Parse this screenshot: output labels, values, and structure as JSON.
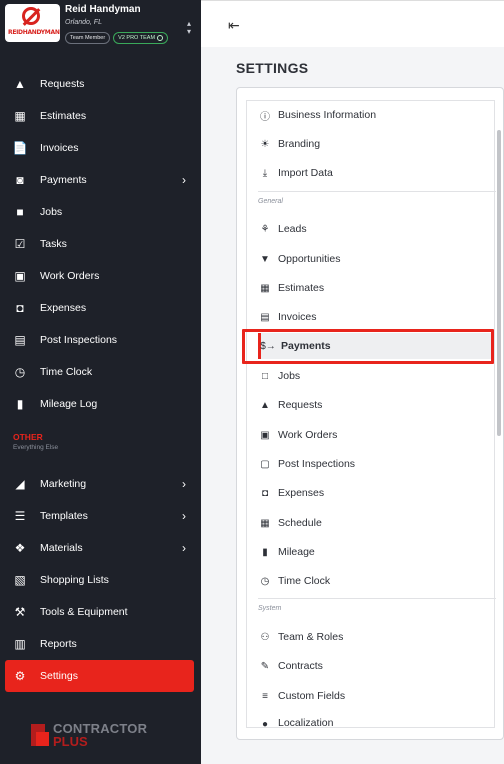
{
  "company": {
    "logo_text": "REIDHANDYMAN",
    "name": "Reid Handyman",
    "location": "Orlando, FL",
    "badges": [
      "Team Member",
      "V2 PRO TEAM"
    ]
  },
  "sidebar": {
    "items": [
      {
        "label": "Requests",
        "icon": "requests-icon"
      },
      {
        "label": "Estimates",
        "icon": "estimates-icon"
      },
      {
        "label": "Invoices",
        "icon": "invoices-icon"
      },
      {
        "label": "Payments",
        "icon": "payments-icon",
        "expandable": true
      },
      {
        "label": "Jobs",
        "icon": "jobs-icon"
      },
      {
        "label": "Tasks",
        "icon": "tasks-icon"
      },
      {
        "label": "Work Orders",
        "icon": "work-orders-icon"
      },
      {
        "label": "Expenses",
        "icon": "expenses-icon"
      },
      {
        "label": "Post Inspections",
        "icon": "post-inspections-icon"
      },
      {
        "label": "Time Clock",
        "icon": "clock-icon"
      },
      {
        "label": "Mileage Log",
        "icon": "fuel-icon"
      }
    ],
    "other_title": "OTHER",
    "other_subtitle": "Everything Else",
    "other_items": [
      {
        "label": "Marketing",
        "icon": "megaphone-icon",
        "expandable": true
      },
      {
        "label": "Templates",
        "icon": "templates-icon",
        "expandable": true
      },
      {
        "label": "Materials",
        "icon": "materials-icon",
        "expandable": true
      },
      {
        "label": "Shopping Lists",
        "icon": "cart-icon"
      },
      {
        "label": "Tools & Equipment",
        "icon": "tools-icon"
      },
      {
        "label": "Reports",
        "icon": "reports-icon"
      },
      {
        "label": "Settings",
        "icon": "gear-icon",
        "active": true
      }
    ],
    "brand_top": "CONTRACTOR",
    "brand_bottom": "PLUS"
  },
  "main": {
    "page_title": "SETTINGS",
    "menu": {
      "top_items": [
        "Business Information",
        "Branding",
        "Import Data"
      ],
      "general_label": "General",
      "general_items": [
        "Leads",
        "Opportunities",
        "Estimates",
        "Invoices",
        "Payments",
        "Jobs",
        "Requests",
        "Work Orders",
        "Post Inspections",
        "Expenses",
        "Schedule",
        "Mileage",
        "Time Clock"
      ],
      "system_label": "System",
      "system_items": [
        "Team & Roles",
        "Contracts",
        "Custom Fields",
        "Localization"
      ],
      "selected": "Payments"
    }
  },
  "colors": {
    "sidebar_bg": "#1e2129",
    "accent": "#e8241c",
    "panel_bg": "#ffffff"
  }
}
